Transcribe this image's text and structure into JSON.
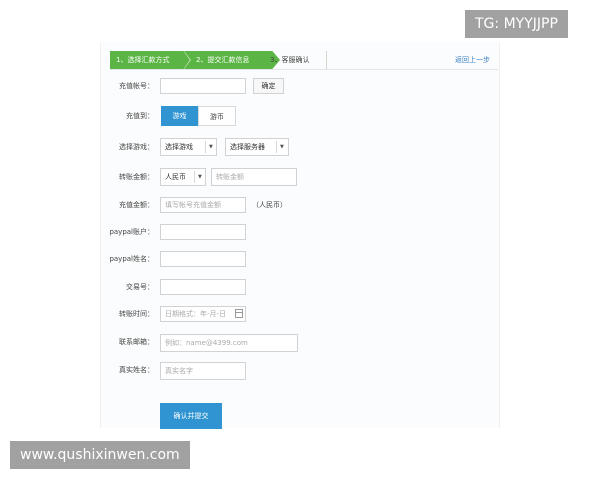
{
  "steps": [
    {
      "label": "1、选择汇款方式"
    },
    {
      "label": "2、提交汇款信息"
    },
    {
      "label": "3、客服确认"
    }
  ],
  "back_link": "返回上一步",
  "form": {
    "account": {
      "label": "充值帐号：",
      "value": "",
      "confirm_button": "确定"
    },
    "recharge_to": {
      "label": "充值到：",
      "options": [
        "游戏",
        "游币"
      ],
      "selected": "游戏"
    },
    "game": {
      "label": "选择游戏：",
      "game_select": "选择游戏",
      "server_select": "选择服务器"
    },
    "transfer_amount": {
      "label": "转账金额：",
      "currency": "人民币",
      "placeholder": "转账金额"
    },
    "recharge_amount": {
      "label": "充值金额：",
      "placeholder": "填写帐号充值金额",
      "unit": "（人民币）"
    },
    "paypal_account": {
      "label": "paypal账户：",
      "value": ""
    },
    "paypal_name": {
      "label": "paypal姓名：",
      "value": ""
    },
    "transaction_no": {
      "label": "交易号：",
      "value": ""
    },
    "transfer_time": {
      "label": "转账时间：",
      "placeholder": "日期格式：年-月-日"
    },
    "email": {
      "label": "联系邮箱：",
      "placeholder": "例如：name@4399.com"
    },
    "real_name": {
      "label": "真实姓名：",
      "placeholder": "真实名字"
    },
    "submit": "确认并提交"
  },
  "watermarks": {
    "top_right": "TG: MYYJJPP",
    "bottom_left": "www.qushixinwen.com"
  },
  "colors": {
    "step_active": "#5bb544",
    "primary_button": "#2f94d1",
    "link": "#3a7fc0"
  }
}
